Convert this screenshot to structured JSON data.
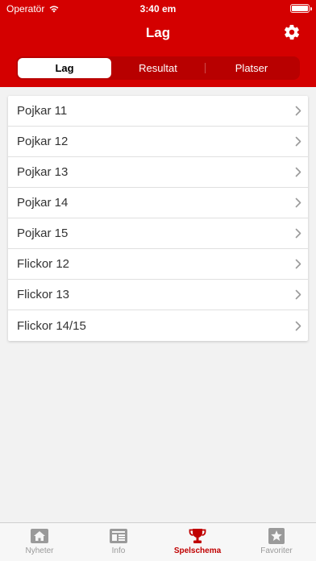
{
  "status_bar": {
    "carrier": "Operatör",
    "time": "3:40 em"
  },
  "nav": {
    "title": "Lag"
  },
  "segments": [
    {
      "label": "Lag",
      "active": true
    },
    {
      "label": "Resultat",
      "active": false
    },
    {
      "label": "Platser",
      "active": false
    }
  ],
  "list": {
    "items": [
      {
        "label": "Pojkar 11"
      },
      {
        "label": "Pojkar 12"
      },
      {
        "label": "Pojkar 13"
      },
      {
        "label": "Pojkar 14"
      },
      {
        "label": "Pojkar 15"
      },
      {
        "label": "Flickor 12"
      },
      {
        "label": "Flickor 13"
      },
      {
        "label": "Flickor 14/15"
      }
    ]
  },
  "tabbar": {
    "tabs": [
      {
        "label": "Nyheter",
        "icon": "home-icon"
      },
      {
        "label": "Info",
        "icon": "newspaper-icon"
      },
      {
        "label": "Spelschema",
        "icon": "trophy-icon",
        "active": true
      },
      {
        "label": "Favoriter",
        "icon": "star-icon"
      }
    ]
  },
  "colors": {
    "brand": "#d40000",
    "accent_dark": "#b80000",
    "tab_active": "#c00000",
    "tab_inactive": "#999999"
  }
}
